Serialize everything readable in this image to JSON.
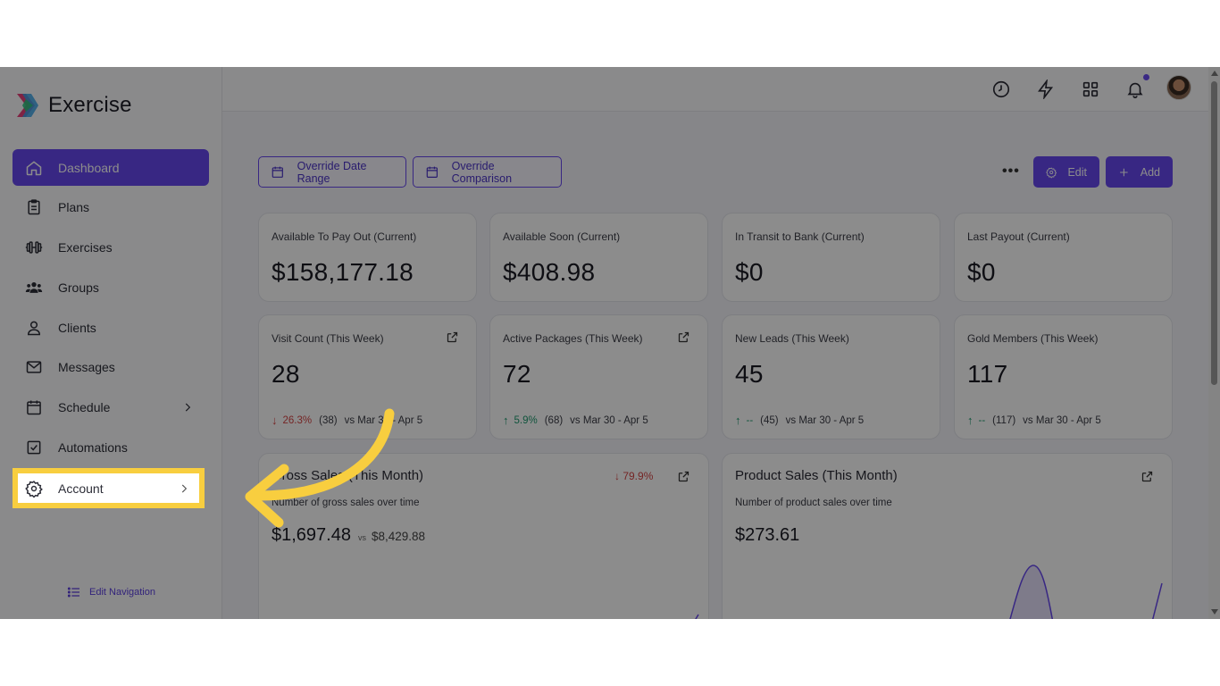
{
  "app": {
    "name": "Exercise"
  },
  "sidebar": {
    "items": [
      {
        "label": "Dashboard",
        "icon": "home-icon"
      },
      {
        "label": "Plans",
        "icon": "clipboard-icon"
      },
      {
        "label": "Exercises",
        "icon": "dumbbell-icon"
      },
      {
        "label": "Groups",
        "icon": "users-icon"
      },
      {
        "label": "Clients",
        "icon": "user-icon"
      },
      {
        "label": "Messages",
        "icon": "mail-icon"
      },
      {
        "label": "Schedule",
        "icon": "calendar-icon"
      },
      {
        "label": "Automations",
        "icon": "checkbox-icon"
      },
      {
        "label": "Account",
        "icon": "gear-icon"
      }
    ],
    "edit_navigation": "Edit Navigation"
  },
  "toolbar": {
    "override_date_range": "Override Date Range",
    "override_comparison": "Override Comparison",
    "more": "•••",
    "edit": "Edit",
    "add": "Add"
  },
  "stats_row1": [
    {
      "label": "Available To Pay Out (Current)",
      "value": "$158,177.18"
    },
    {
      "label": "Available Soon (Current)",
      "value": "$408.98"
    },
    {
      "label": "In Transit to Bank (Current)",
      "value": "$0"
    },
    {
      "label": "Last Payout (Current)",
      "value": "$0"
    }
  ],
  "stats_row2": [
    {
      "label": "Visit Count (This Week)",
      "value": "28",
      "arrow": "↓",
      "pct": "26.3%",
      "count": "(38)",
      "vs": "vs Mar 30 - Apr 5"
    },
    {
      "label": "Active Packages (This Week)",
      "value": "72",
      "arrow": "↑",
      "pct": "5.9%",
      "count": "(68)",
      "vs": "vs Mar 30 - Apr 5"
    },
    {
      "label": "New Leads (This Week)",
      "value": "45",
      "arrow": "↑",
      "pct": "--",
      "count": "(45)",
      "vs": "vs Mar 30 - Apr 5"
    },
    {
      "label": "Gold Members (This Week)",
      "value": "117",
      "arrow": "↑",
      "pct": "--",
      "count": "(117)",
      "vs": "vs Mar 30 - Apr 5"
    }
  ],
  "gross_sales": {
    "title": "Gross Sales (This Month)",
    "pct": "↓ 79.9%",
    "subtitle": "Number of gross sales over time",
    "amount": "$1,697.48",
    "vs": "vs",
    "vs_amount": "$8,429.88"
  },
  "product_sales": {
    "title": "Product Sales (This Month)",
    "subtitle": "Number of product sales over time",
    "amount": "$273.61"
  },
  "colors": {
    "accent": "#6747ef",
    "highlight": "#f8ce3f",
    "negative": "#d64545",
    "positive": "#1f9a6f"
  }
}
